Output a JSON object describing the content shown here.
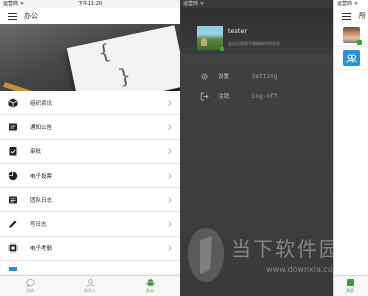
{
  "left_phone": {
    "status": {
      "carrier": "运营商 ᯤ",
      "time": "下午11:20"
    },
    "nav_title": "办公",
    "menu": [
      {
        "label": "组织资讯",
        "icon": "cube-icon"
      },
      {
        "label": "通知公告",
        "icon": "notice-icon"
      },
      {
        "label": "审批",
        "icon": "approval-icon"
      },
      {
        "label": "电子投票",
        "icon": "pie-icon"
      },
      {
        "label": "团队日志",
        "icon": "log-icon"
      },
      {
        "label": "写日志",
        "icon": "pen-icon"
      },
      {
        "label": "电子考勤",
        "icon": "chip-icon"
      },
      {
        "label": "",
        "icon": "partial-icon"
      }
    ],
    "tabs": [
      {
        "label": "消息",
        "icon": "chat-icon",
        "active": false
      },
      {
        "label": "联系人",
        "icon": "contacts-icon",
        "active": false
      },
      {
        "label": "办公",
        "icon": "android-icon",
        "active": true
      }
    ]
  },
  "drawer": {
    "status": {
      "carrier": "运营商 ᯤ"
    },
    "username": "tester",
    "signature": "会议日程表不断刷新中的会议",
    "items": [
      {
        "label": "设置",
        "sub": "Setting",
        "icon": "gear-icon"
      },
      {
        "label": "注销",
        "sub": "Log-off",
        "icon": "logout-icon"
      }
    ]
  },
  "watermark": {
    "text": "当下软件园",
    "url": "www.downxia.com"
  },
  "right_phone": {
    "status": {
      "carrier": "运营商 ᯤ"
    },
    "nav_title": "所",
    "tab_label": "消息"
  },
  "colors": {
    "accent_green": "#3aa33a",
    "drawer_bg": "#3a3a3a",
    "blue": "#2e8fd6"
  }
}
